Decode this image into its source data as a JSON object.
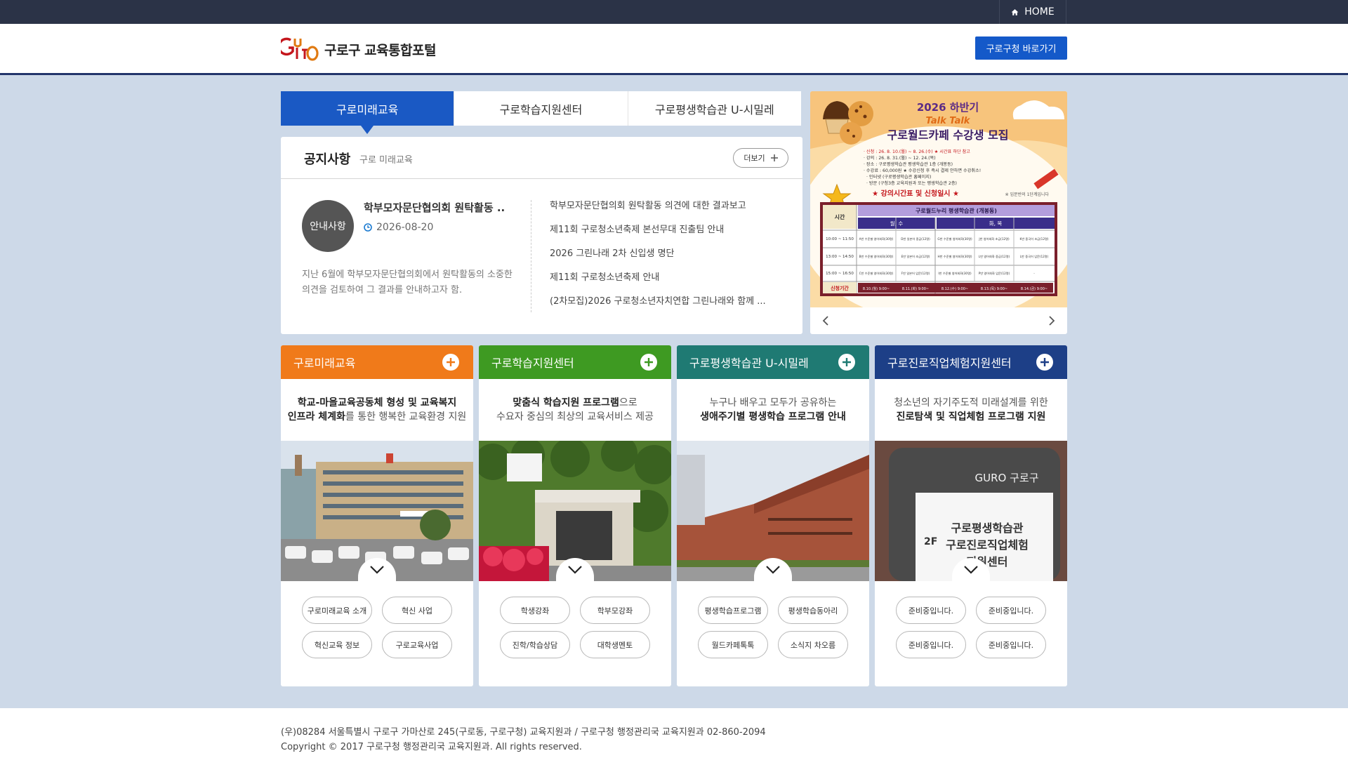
{
  "topbar": {
    "home_label": "HOME"
  },
  "header": {
    "logo_mark": "GURO",
    "logo_text": "구로구 교육통합포털",
    "guro_link": "구로구청 바로가기"
  },
  "tabs": [
    {
      "label": "구로미래교육"
    },
    {
      "label": "구로학습지원센터"
    },
    {
      "label": "구로평생학습관 U-시밀레"
    }
  ],
  "notice": {
    "title": "공지사항",
    "subtitle": "구로 미래교육",
    "more_label": "더보기",
    "badge": "안내사항",
    "featured_title": "학부모자문단협의회 원탁활동 ..",
    "featured_date": "2026-08-20",
    "featured_desc": "지난 6월에 학부모자문단협의회에서 원탁활동의 소중한 의견을 검토하여 그 결과를 안내하고자 함.",
    "items": [
      "학부모자문단협의회 원탁활동 의견에 대한 결과보고",
      "제11회 구로청소년축제 본선무대 진출팀 안내",
      "2026 그린나래 2차 신입생 명단",
      "제11회 구로청소년축제 안내",
      "(2차모집)2026 구로청소년자치연합 그린나래와 함께 ..."
    ]
  },
  "banner": {
    "year_title": "2026 하반기",
    "talk": "Talk Talk",
    "title": "구로월드카페 수강생 모집",
    "info": [
      "· 신청 : 26. 8. 10.(월) ~ 8. 26.(수)  ★ 시간표 하단 참고",
      "· 강의 : 26. 8. 31.(월) ~ 12. 24.(목)",
      "· 장소 : 구로평생학습관 평생학습관 1층 (개봉동)",
      "· 수강료 : 60,000원   ★ 수강신청 후 즉시 결제 안하면 수강취소!",
      "· 인터넷 (구로평생학습관 홈페이지)",
      "· 방문 (구청3층 교육지원과 또는 평생학습관 2층)"
    ],
    "subheading": "★ 강의시간표 및 신청일시 ★",
    "note": "※ 입문반의 1단계입니다",
    "table_header": "구로월드누리 평생학습관 (개봉동)",
    "time_label": "시간",
    "day1": "월, 수",
    "day2": "화, 목",
    "rows": [
      {
        "time": "10:00 ~ 11:50",
        "cells": [
          "A반 수준별 영어회화(30명)",
          "D반 일본어 중급(12명)",
          "G반 수준별 영어회화(30명)",
          "J반 영어회화 초급(12명)",
          "K반 중국어 초급(12명)"
        ]
      },
      {
        "time": "13:00 ~ 14:50",
        "cells": [
          "B반 수준별 영어회화(30명)",
          "E반 일본어 초급(12명)",
          "H반 수준별 영어회화(30명)",
          "L반 영어회화 중급(12명)",
          "L반 중국어 입문(12명)"
        ]
      },
      {
        "time": "15:00 ~ 16:50",
        "cells": [
          "C반 수준별 영어회화(30명)",
          "F반 일본어 입문(12명)",
          "I반 수준별 영어회화(30명)",
          "P반 영어회화 입문(12명)",
          "-"
        ]
      }
    ],
    "apply_label": "신청기간",
    "apply_dates": [
      "8.10.(월) 9:00~",
      "8.11.(화) 9:00~",
      "8.12.(수) 9:00~",
      "8.13.(목) 9:00~",
      "8.14.(금) 9:00~"
    ]
  },
  "cards": [
    {
      "title": "구로미래교육",
      "color": "#f07a1a",
      "desc_line1": [
        {
          "t": "학교-마을교육공동체 형성 및 교육복지",
          "b": true
        }
      ],
      "desc_line2": [
        {
          "t": "인프라 체계화",
          "b": true
        },
        {
          "t": "를 통한 행복한 교육환경 지원",
          "b": false
        }
      ],
      "buttons": [
        "구로미래교육 소개",
        "혁신 사업",
        "혁신교육 정보",
        "구로교육사업"
      ]
    },
    {
      "title": "구로학습지원센터",
      "color": "#3e9a22",
      "desc_line1": [
        {
          "t": "맞춤식 학습지원 프로그램",
          "b": true
        },
        {
          "t": "으로",
          "b": false
        }
      ],
      "desc_line2": [
        {
          "t": "수요자 중심의 최상의 교육서비스 제공",
          "b": false
        }
      ],
      "buttons": [
        "학생강좌",
        "학부모강좌",
        "진학/학습상담",
        "대학생멘토"
      ]
    },
    {
      "title": "구로평생학습관 U-시밀레",
      "color": "#1f7a73",
      "desc_line1": [
        {
          "t": "누구나 배우고 모두가 공유하는",
          "b": false
        }
      ],
      "desc_line2": [
        {
          "t": "생애주기별 평생학습 프로그램 안내",
          "b": true
        }
      ],
      "buttons": [
        "평생학습프로그램",
        "평생학습동아리",
        "월드카페톡톡",
        "소식지 차오름"
      ]
    },
    {
      "title": "구로진로직업체험지원센터",
      "color": "#1d3f87",
      "desc_line1": [
        {
          "t": "청소년의 자기주도적 미래설계를 위한",
          "b": false
        }
      ],
      "desc_line2": [
        {
          "t": "진로탐색 및 직업체험 프로그램 지원",
          "b": true
        }
      ],
      "buttons": [
        "준비중입니다.",
        "준비중입니다.",
        "준비중입니다.",
        "준비중입니다."
      ],
      "sign": {
        "logo": "GURO 구로구",
        "floor": "2F",
        "lines": [
          "구로평생학습관",
          "구로진로직업체험",
          "지원센터"
        ]
      }
    }
  ],
  "footer": {
    "address": "(우)08284 서울특별시 구로구 가마산로 245(구로동, 구로구청) 교육지원과 / 구로구청 행정관리국 교육지원과 02-860-2094",
    "copyright": "Copyright © 2017 구로구청 행정관리국 교육지원과. All rights reserved."
  }
}
